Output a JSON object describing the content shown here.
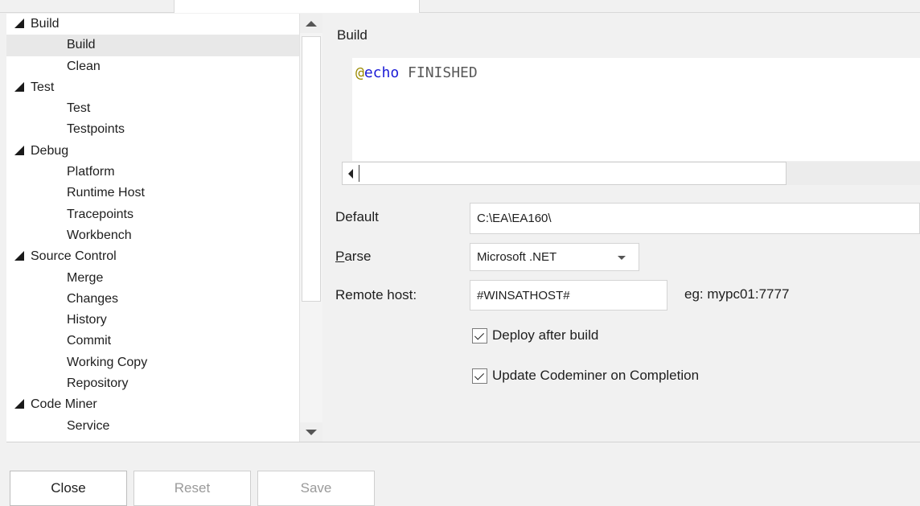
{
  "tree": {
    "items": [
      {
        "label": "Build",
        "level": "group",
        "selected": false
      },
      {
        "label": "Build",
        "level": "child",
        "selected": true
      },
      {
        "label": "Clean",
        "level": "child",
        "selected": false
      },
      {
        "label": "Test",
        "level": "group",
        "selected": false
      },
      {
        "label": "Test",
        "level": "child",
        "selected": false
      },
      {
        "label": "Testpoints",
        "level": "child",
        "selected": false
      },
      {
        "label": "Debug",
        "level": "group",
        "selected": false
      },
      {
        "label": "Platform",
        "level": "child",
        "selected": false
      },
      {
        "label": "Runtime Host",
        "level": "child",
        "selected": false
      },
      {
        "label": "Tracepoints",
        "level": "child",
        "selected": false
      },
      {
        "label": "Workbench",
        "level": "child",
        "selected": false
      },
      {
        "label": "Source Control",
        "level": "group",
        "selected": false
      },
      {
        "label": "Merge",
        "level": "child",
        "selected": false
      },
      {
        "label": "Changes",
        "level": "child",
        "selected": false
      },
      {
        "label": "History",
        "level": "child",
        "selected": false
      },
      {
        "label": "Commit",
        "level": "child",
        "selected": false
      },
      {
        "label": "Working Copy",
        "level": "child",
        "selected": false
      },
      {
        "label": "Repository",
        "level": "child",
        "selected": false
      },
      {
        "label": "Code Miner",
        "level": "group",
        "selected": false
      },
      {
        "label": "Service",
        "level": "child",
        "selected": false
      }
    ],
    "expand_icon": "expanded-triangle-icon"
  },
  "section": {
    "title": "Build",
    "code": {
      "at": "@",
      "keyword": "echo",
      "rest": " FINISHED"
    }
  },
  "form": {
    "default_label": "Default",
    "default_value": "C:\\EA\\EA160\\",
    "parse_label": "Parse",
    "parse_value": "Microsoft .NET",
    "remote_label": "Remote host:",
    "remote_value": "#WINSATHOST#",
    "remote_hint": "eg: mypc01:7777",
    "deploy_label": "Deploy after build",
    "deploy_checked": true,
    "update_label": "Update Codeminer on Completion",
    "update_checked": true
  },
  "buttons": {
    "close": "Close",
    "reset": "Reset",
    "save": "Save"
  },
  "colors": {
    "at_symbol": "#9b8a00",
    "keyword": "#1b1bd6",
    "selection": "#e8e8e8"
  }
}
